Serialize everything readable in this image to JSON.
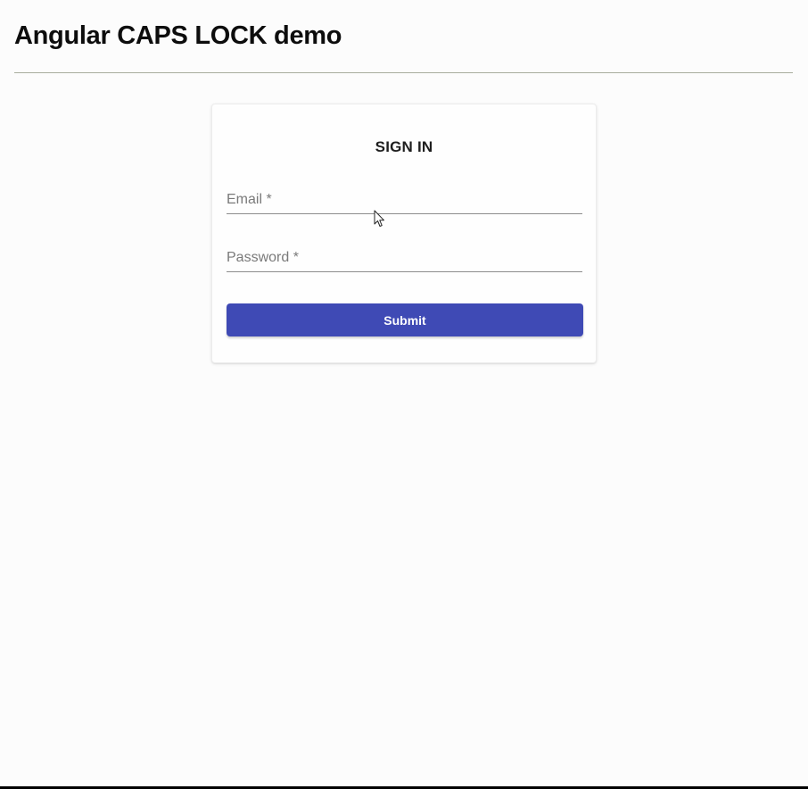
{
  "header": {
    "title": "Angular CAPS LOCK demo"
  },
  "signin": {
    "title": "SIGN IN",
    "email": {
      "label": "Email *",
      "value": ""
    },
    "password": {
      "label": "Password *",
      "value": ""
    },
    "submit_label": "Submit"
  },
  "colors": {
    "primary": "#3f4ab5",
    "divider": "#a8ad9e",
    "background": "#fcfcfc"
  },
  "icons": {
    "cursor": "mouse-pointer-icon"
  }
}
